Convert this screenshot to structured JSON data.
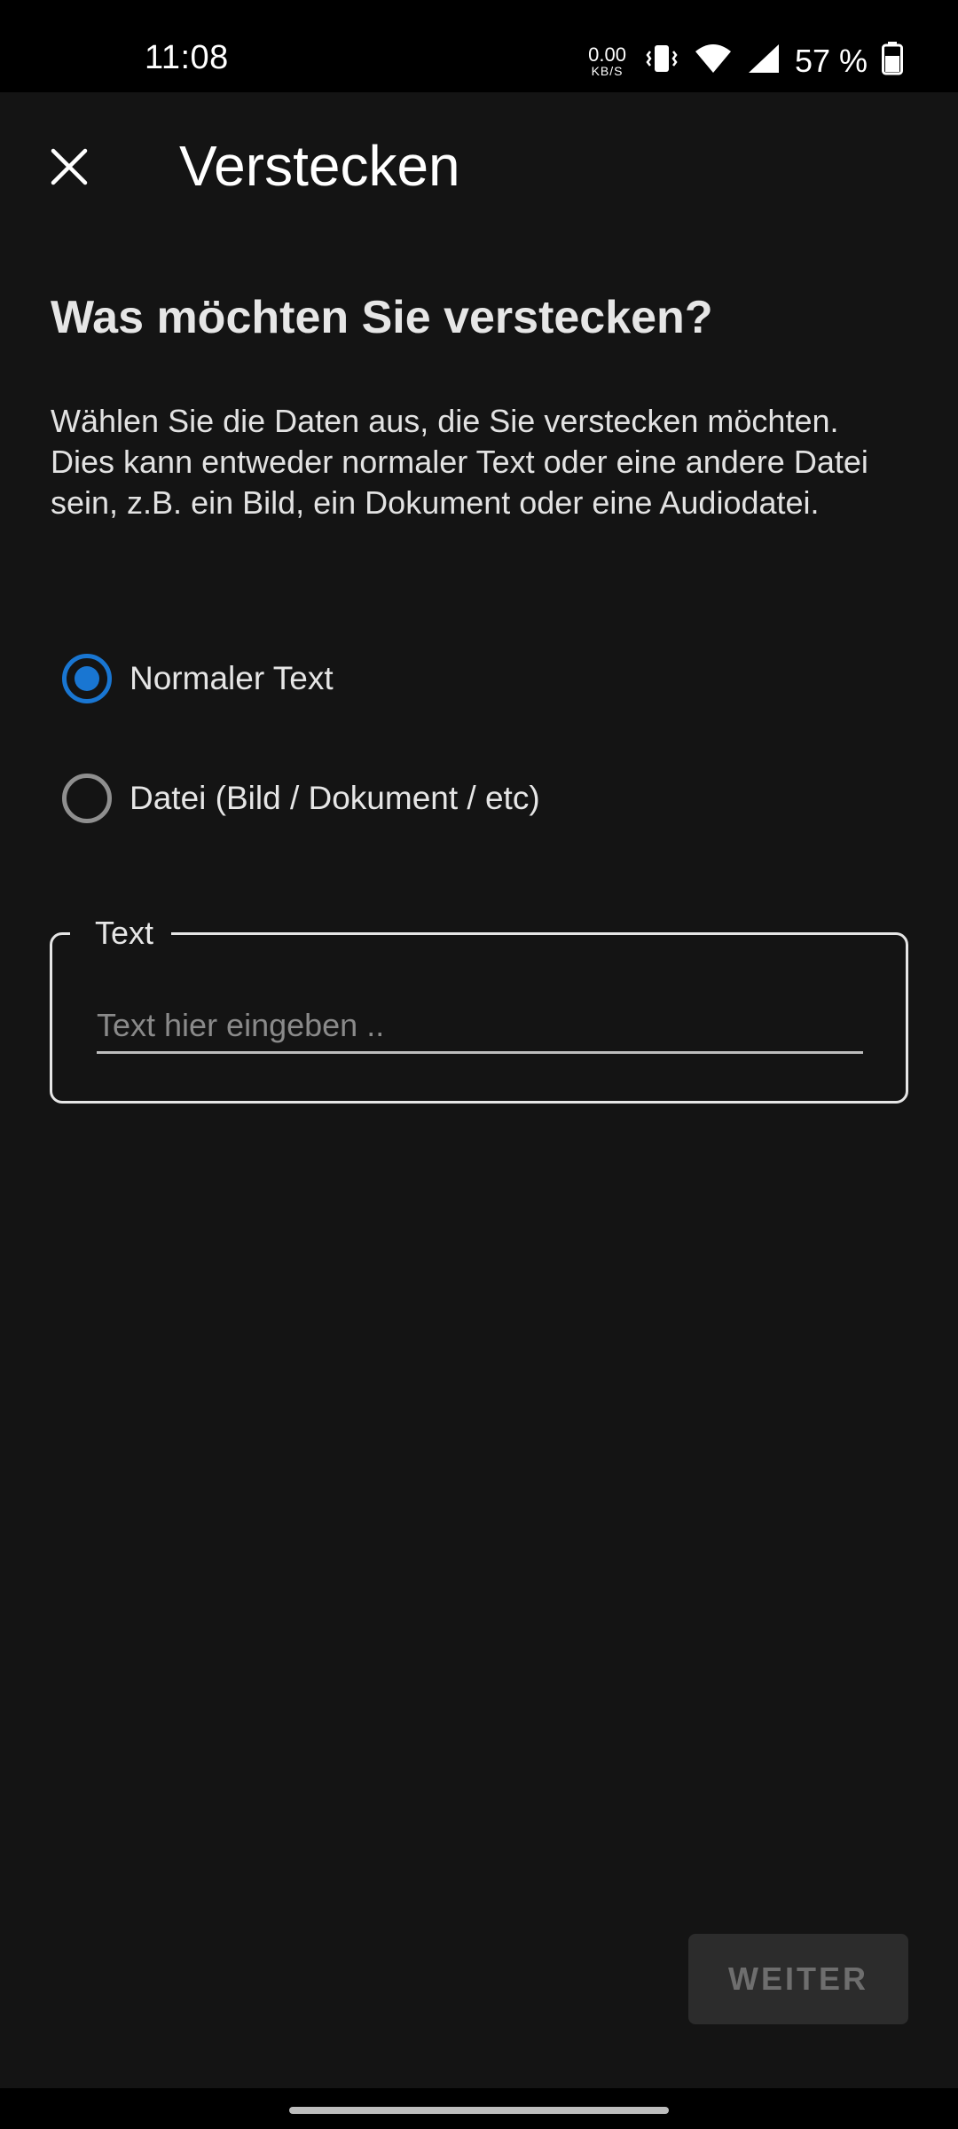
{
  "status_bar": {
    "time": "11:08",
    "net_speed_value": "0.00",
    "net_speed_unit": "KB/S",
    "battery_percent": "57 %",
    "icons": [
      "vibrate-icon",
      "wifi-icon",
      "signal-icon",
      "battery-icon"
    ]
  },
  "app_bar": {
    "close_icon": "close-icon",
    "title": "Verstecken"
  },
  "content": {
    "heading": "Was möchten Sie verstecken?",
    "description": "Wählen Sie die Daten aus, die Sie verstecken möchten. Dies kann entweder normaler Text oder eine andere Datei sein, z.B. ein Bild, ein Dokument oder eine Audiodatei.",
    "options": [
      {
        "label": "Normaler Text",
        "selected": true
      },
      {
        "label": "Datei (Bild / Dokument / etc)",
        "selected": false
      }
    ],
    "text_field": {
      "label": "Text",
      "value": "",
      "placeholder": "Text hier eingeben .."
    }
  },
  "actions": {
    "next_label": "WEITER",
    "next_enabled": false
  },
  "colors": {
    "background": "#141414",
    "accent": "#1976d2",
    "status_bar": "#000000"
  }
}
